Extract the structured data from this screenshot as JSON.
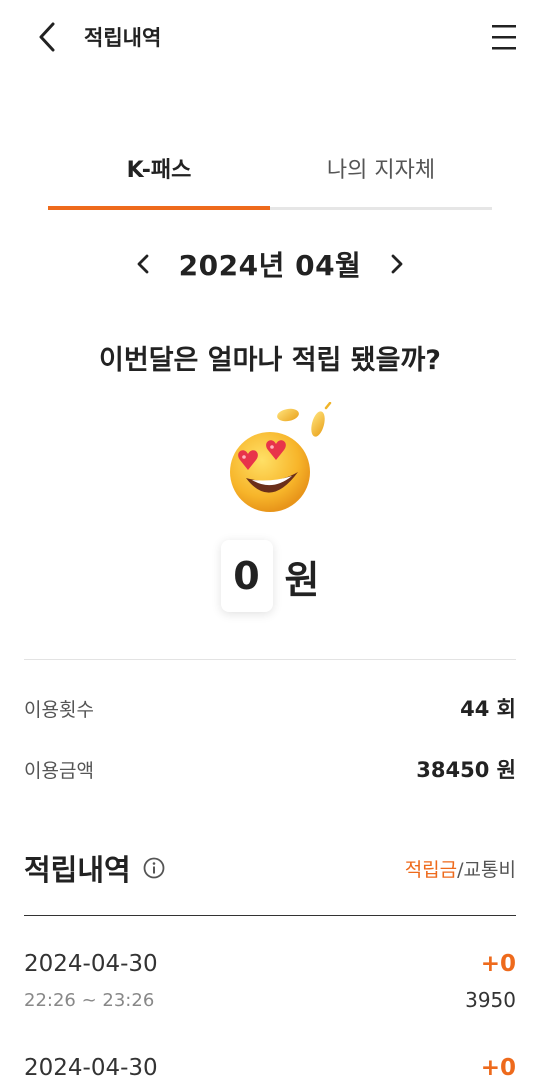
{
  "header": {
    "title": "적립내역",
    "back_icon": "chevron-left-icon",
    "menu_icon": "hamburger-menu-icon"
  },
  "tabs": [
    {
      "label": "K-패스",
      "active": true
    },
    {
      "label": "나의 지자체",
      "active": false
    }
  ],
  "month_nav": {
    "label": "2024년 04월",
    "prev_icon": "chevron-left-icon",
    "next_icon": "chevron-right-icon"
  },
  "summary": {
    "question": "이번달은 얼마나 적립 됐을까?",
    "emoji_icon": "heart-eyes-coin-emoji",
    "amount": "0",
    "unit": "원"
  },
  "stats": {
    "usage_count_label": "이용횟수",
    "usage_count_value": "44 회",
    "usage_amount_label": "이용금액",
    "usage_amount_value": "38450 원"
  },
  "history": {
    "title": "적립내역",
    "info_icon": "info-circle-icon",
    "toggle_active": "적립금",
    "toggle_separator": "/",
    "toggle_inactive": "교통비",
    "entries": [
      {
        "date": "2024-04-30",
        "reward": "+0",
        "time": "22:26 ~ 23:26",
        "fare": "3950"
      },
      {
        "date": "2024-04-30",
        "reward": "+0"
      }
    ]
  },
  "colors": {
    "accent": "#ee6a1c",
    "text": "#222222",
    "muted": "#555555"
  }
}
